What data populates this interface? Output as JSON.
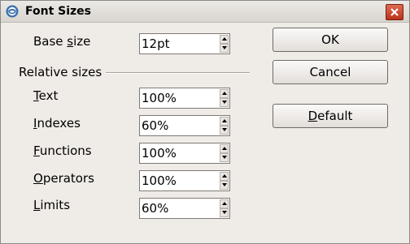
{
  "window": {
    "title": "Font Sizes"
  },
  "form": {
    "base_size": {
      "label": "Base size",
      "value": "12pt"
    },
    "section_label": "Relative sizes",
    "rows": [
      {
        "label": "Text",
        "value": "100%"
      },
      {
        "label": "Indexes",
        "value": "60%"
      },
      {
        "label": "Functions",
        "value": "100%"
      },
      {
        "label": "Operators",
        "value": "100%"
      },
      {
        "label": "Limits",
        "value": "60%"
      }
    ]
  },
  "buttons": {
    "ok": "OK",
    "cancel": "Cancel",
    "default": "Default"
  },
  "icons": {
    "app": "app-icon",
    "close": "close-icon",
    "spin_up": "chevron-up-icon",
    "spin_down": "chevron-down-icon"
  }
}
